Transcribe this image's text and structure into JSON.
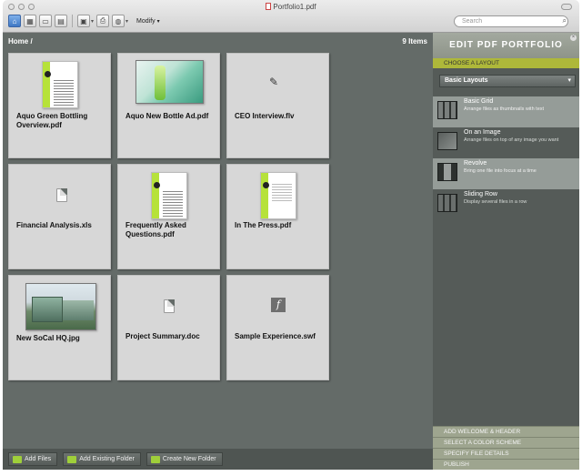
{
  "window": {
    "title": "Portfolio1.pdf"
  },
  "toolbar": {
    "modify_label": "Modify",
    "modify_arrow": "▾",
    "search_placeholder": "Search"
  },
  "main": {
    "breadcrumb": "Home /",
    "item_count": "9 Items",
    "files": [
      {
        "name": "Aquo Green Bottling Overview.pdf"
      },
      {
        "name": "Aquo New Bottle Ad.pdf"
      },
      {
        "name": "CEO Interview.flv"
      },
      {
        "name": "Financial Analysis.xls"
      },
      {
        "name": "Frequently Asked Questions.pdf"
      },
      {
        "name": "In The Press.pdf"
      },
      {
        "name": "New SoCal HQ.jpg"
      },
      {
        "name": "Project Summary.doc"
      },
      {
        "name": "Sample Experience.swf"
      }
    ]
  },
  "bottom_bar": {
    "add_files": "Add Files",
    "add_existing_folder": "Add Existing Folder",
    "create_new_folder": "Create New Folder"
  },
  "panel": {
    "title": "EDIT PDF PORTFOLIO",
    "choose_layout": "CHOOSE A LAYOUT",
    "dropdown_value": "Basic Layouts",
    "layouts": [
      {
        "name": "Basic Grid",
        "desc": "Arrange files as thumbnails with text",
        "selected": true
      },
      {
        "name": "On an Image",
        "desc": "Arrange files on top of any image you want",
        "selected": false
      },
      {
        "name": "Revolve",
        "desc": "Bring one file into focus at a time",
        "selected": true
      },
      {
        "name": "Sliding Row",
        "desc": "Display several files in a row",
        "selected": false
      }
    ],
    "footer": [
      "ADD WELCOME & HEADER",
      "SELECT A COLOR SCHEME",
      "SPECIFY FILE DETAILS",
      "PUBLISH"
    ]
  },
  "colors": {
    "accent_green": "#aeb83a",
    "workspace": "#646b68",
    "panel": "#555b58"
  }
}
